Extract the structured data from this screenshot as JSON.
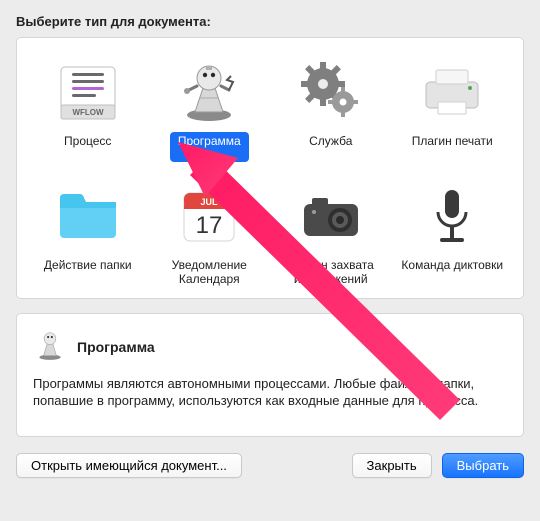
{
  "prompt": "Выберите тип для документа:",
  "types": [
    {
      "key": "workflow",
      "label": "Процесс",
      "icon": "workflow-icon"
    },
    {
      "key": "application",
      "label": "Программа",
      "icon": "application-icon",
      "selected": true
    },
    {
      "key": "service",
      "label": "Служба",
      "icon": "service-icon"
    },
    {
      "key": "print_plugin",
      "label": "Плагин печати",
      "icon": "printer-icon"
    },
    {
      "key": "folder_action",
      "label": "Действие папки",
      "icon": "folder-icon"
    },
    {
      "key": "calendar_alarm",
      "label": "Уведомление Календаря",
      "icon": "calendar-icon"
    },
    {
      "key": "image_capture_plugin",
      "label": "Плагин захвата изображений",
      "icon": "camera-icon"
    },
    {
      "key": "dictation_command",
      "label": "Команда диктовки",
      "icon": "microphone-icon"
    }
  ],
  "description": {
    "title": "Программа",
    "body": "Программы являются автономными процессами. Любые файлы и папки, попавшие в программу, используются как входные данные для процесса."
  },
  "buttons": {
    "open_existing": "Открыть имеющийся документ...",
    "close": "Закрыть",
    "choose": "Выбрать"
  },
  "calendar_icon": {
    "month": "JUL",
    "day": "17"
  },
  "wflow_label": "WFLOW"
}
